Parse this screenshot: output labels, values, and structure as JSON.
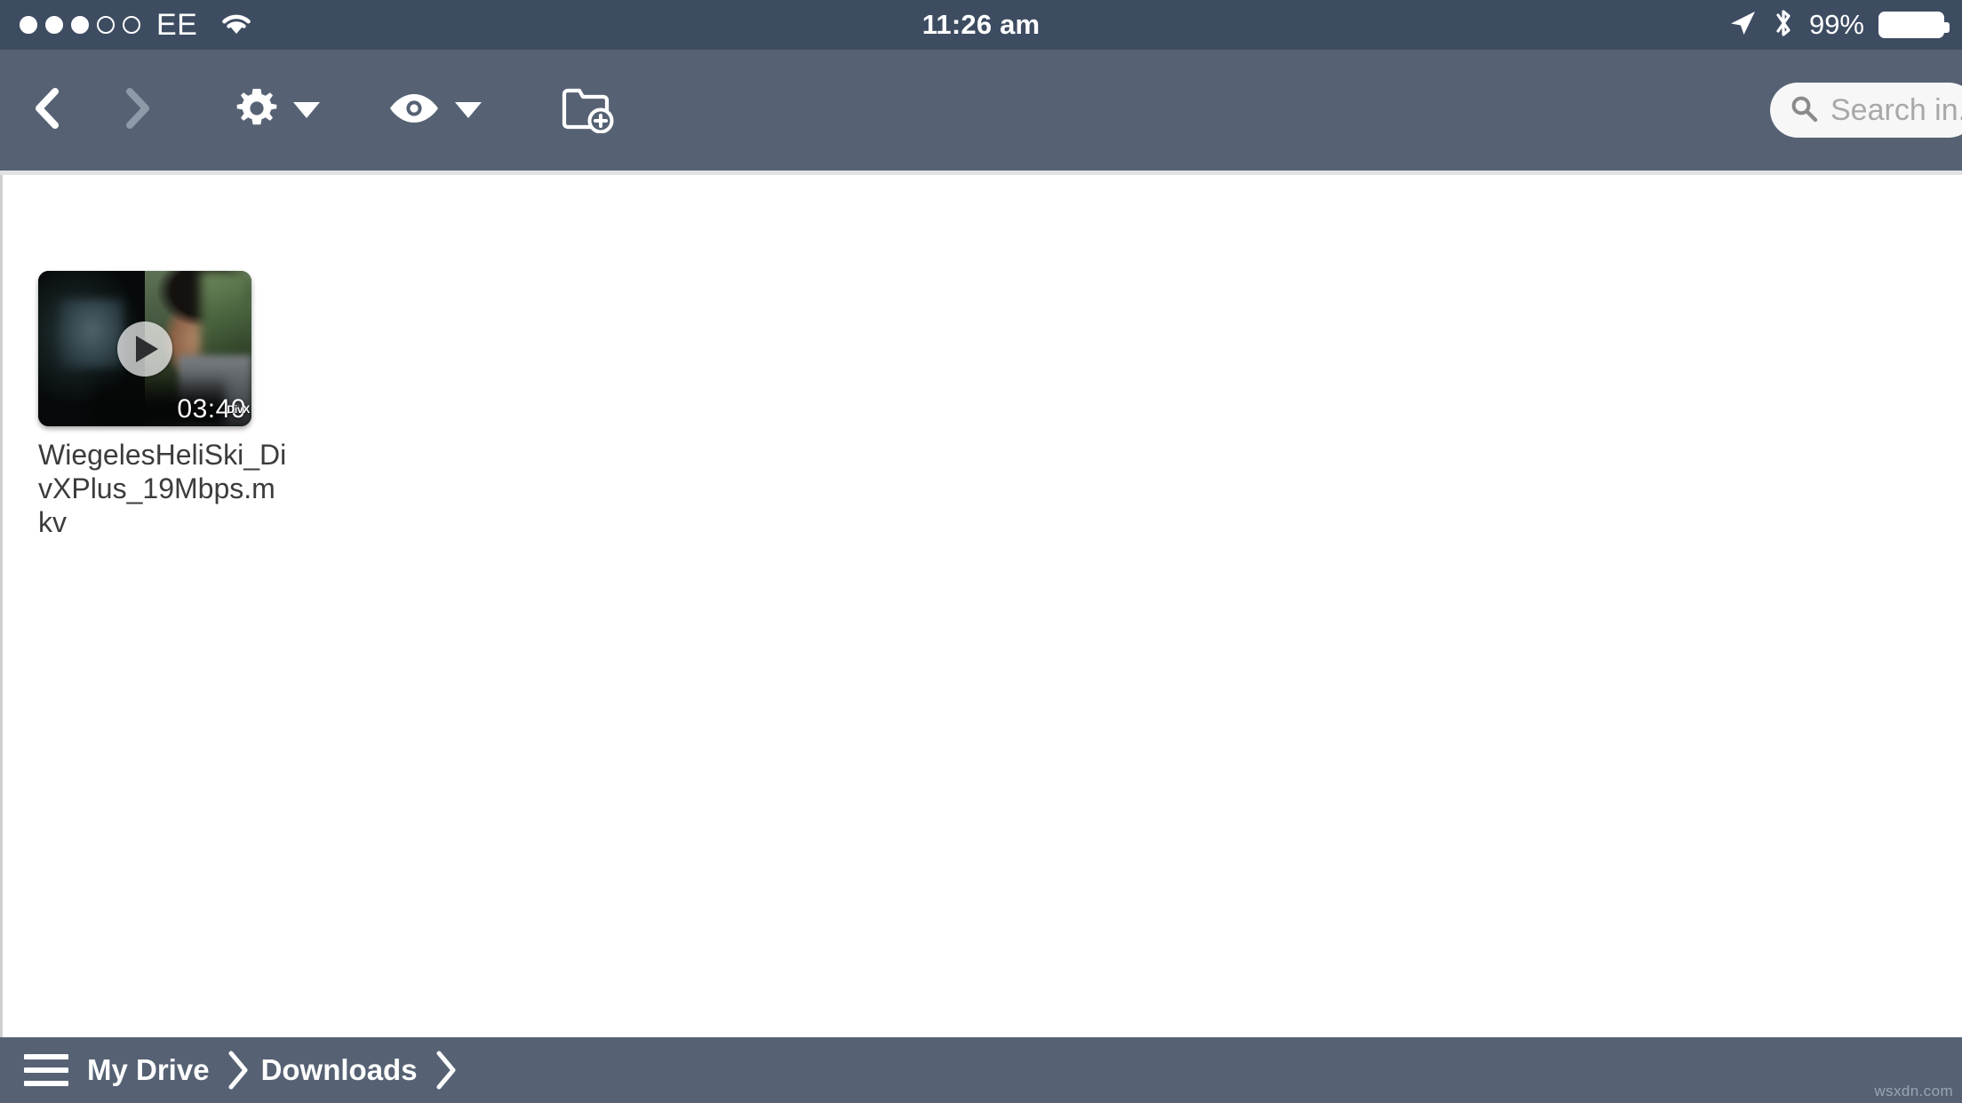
{
  "statusbar": {
    "carrier": "EE",
    "signal_dots_filled": 3,
    "signal_dots_total": 5,
    "wifi_icon": "wifi-icon",
    "time": "11:26 am",
    "location_icon": "location-arrow-icon",
    "bluetooth_icon": "bluetooth-icon",
    "battery_percent": "99%",
    "battery_icon": "battery-full-icon",
    "background_color": "#3e4c62"
  },
  "toolbar": {
    "background_color": "#566274",
    "back_icon": "chevron-left-icon",
    "back_enabled": true,
    "forward_icon": "chevron-right-icon",
    "forward_enabled": false,
    "settings_icon": "gear-icon",
    "settings_caret_icon": "caret-down-icon",
    "view_icon": "eye-icon",
    "view_caret_icon": "caret-down-icon",
    "new_folder_icon": "folder-add-icon",
    "search": {
      "placeholder": "Search in...",
      "value": "",
      "icon": "search-icon"
    }
  },
  "content": {
    "files": [
      {
        "name": "WiegelesHeliSki_DivXPlus_19Mbps.mkv",
        "duration": "03:40",
        "codec_badge": "DivX",
        "play_icon": "play-icon",
        "type": "video"
      }
    ]
  },
  "bottombar": {
    "background_color": "#566274",
    "menu_icon": "hamburger-menu-icon",
    "breadcrumbs": [
      {
        "label": "My Drive",
        "separator_icon": "chevron-right-icon"
      },
      {
        "label": "Downloads",
        "separator_icon": "chevron-right-icon"
      }
    ]
  },
  "watermark": {
    "text": "wsxdn.com"
  }
}
